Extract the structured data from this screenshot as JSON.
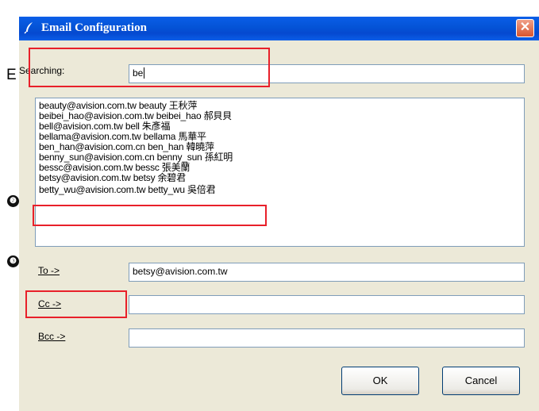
{
  "window": {
    "title": "Email Configuration",
    "close_glyph": "✕"
  },
  "annotations": {
    "e_letter": "E",
    "markers": [
      "❶",
      "❷",
      "❸"
    ]
  },
  "search": {
    "label": "Searching:",
    "value": "be"
  },
  "results": [
    "beauty@avision.com.tw beauty 王秋萍",
    "beibei_hao@avision.com.tw beibei_hao 郝貝貝",
    "bell@avision.com.tw bell 朱彥福",
    "bellama@avision.com.tw bellama 馬華平",
    "ben_han@avision.com.cn ben_han 韓曉萍",
    "benny_sun@avision.com.cn benny_sun 孫紅明",
    "bessc@avision.com.tw bessc 張美蘭",
    "betsy@avision.com.tw betsy 余碧君",
    "betty_wu@avision.com.tw betty_wu 吳倍君"
  ],
  "recipients": {
    "to_label": "To ->",
    "to_value": "betsy@avision.com.tw",
    "cc_label": "Cc ->",
    "cc_value": "",
    "bcc_label": "Bcc ->",
    "bcc_value": ""
  },
  "buttons": {
    "ok": "OK",
    "cancel": "Cancel"
  },
  "colors": {
    "titlebar": "#0453d6",
    "dialog_bg": "#ece9d8",
    "highlight_box": "#e8202a"
  }
}
